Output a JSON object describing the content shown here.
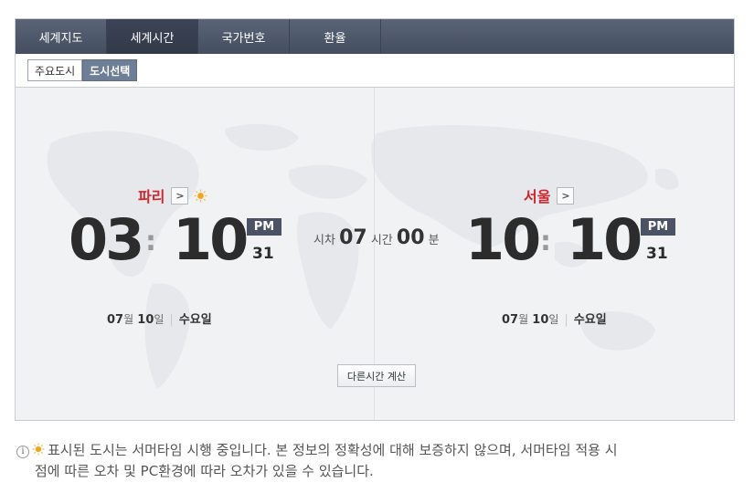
{
  "nav": {
    "tabs": [
      {
        "label": "세계지도"
      },
      {
        "label": "세계시간"
      },
      {
        "label": "국가번호"
      },
      {
        "label": "환율"
      }
    ],
    "active_index": 1
  },
  "subtabs": {
    "major_cities": "주요도시",
    "city_select": "도시선택"
  },
  "left_city": {
    "name": "파리",
    "arrow": ">",
    "hour": "03",
    "minute": "10",
    "ampm": "PM",
    "seconds": "31",
    "month": "07",
    "month_unit": "월",
    "day": "10",
    "day_unit": "일",
    "weekday": "수요일"
  },
  "right_city": {
    "name": "서울",
    "arrow": ">",
    "hour": "10",
    "minute": "10",
    "ampm": "PM",
    "seconds": "31",
    "month": "07",
    "month_unit": "월",
    "day": "10",
    "day_unit": "일",
    "weekday": "수요일"
  },
  "time_diff": {
    "label": "시차",
    "hours": "07",
    "hours_unit": "시간",
    "minutes": "00",
    "minutes_unit": "분"
  },
  "calc_button": "다른시간 계산",
  "notice": {
    "line1": "표시된 도시는 서머타임 시행 중입니다. 본 정보의 정확성에 대해 보증하지 않으며, 서머타임 적용 시",
    "line2": "점에 따른 오차 및 PC환경에 따라 오차가 있을 수 있습니다."
  },
  "colors": {
    "nav_bg": "#4d5669",
    "city_name": "#d0262c",
    "ampm_bg": "#4a5264",
    "subtab_active": "#6e7e97"
  }
}
